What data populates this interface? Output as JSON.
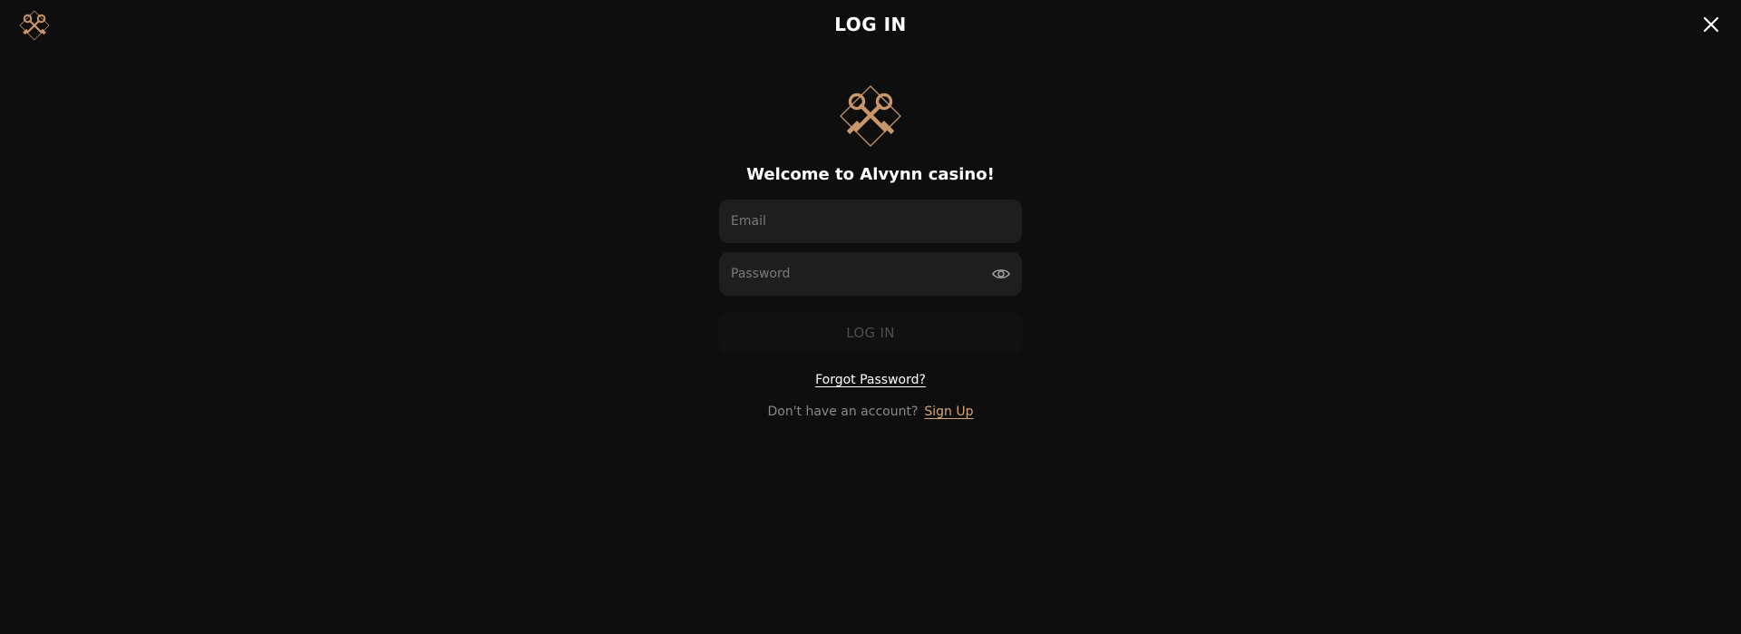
{
  "header": {
    "title": "LOG IN",
    "logo_icon": "crossed-keys-icon",
    "close_icon": "close-icon"
  },
  "form": {
    "welcome": "Welcome to Alvynn casino!",
    "email_placeholder": "Email",
    "email_value": "",
    "password_placeholder": "Password",
    "password_value": "",
    "password_toggle_icon": "eye-icon",
    "submit_label": "LOG IN",
    "forgot_password": "Forgot Password?",
    "signup_prompt": "Don't have an account?",
    "signup_link": "Sign Up"
  },
  "colors": {
    "background": "#0e0e0e",
    "field": "#1e1e1e",
    "accent": "#d6a57a",
    "logo": "#c9966a"
  }
}
